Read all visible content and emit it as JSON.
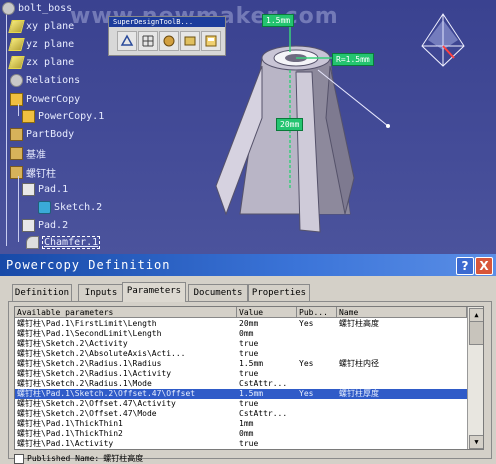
{
  "watermark": "www.newmaker.com",
  "tree": {
    "root": "bolt_boss",
    "items": [
      {
        "label": "xy plane",
        "icon": "plane-icon"
      },
      {
        "label": "yz plane",
        "icon": "plane-icon"
      },
      {
        "label": "zx plane",
        "icon": "plane-icon"
      },
      {
        "label": "Relations",
        "icon": "relations-icon"
      },
      {
        "label": "PowerCopy",
        "icon": "powercopy-icon"
      },
      {
        "label": "PowerCopy.1",
        "icon": "powercopy-icon"
      },
      {
        "label": "PartBody",
        "icon": "partbody-icon"
      },
      {
        "label": "基准",
        "icon": "datum-icon"
      },
      {
        "label": "螺钉柱",
        "icon": "body-icon"
      },
      {
        "label": "Pad.1",
        "icon": "pad-icon"
      },
      {
        "label": "Sketch.2",
        "icon": "sketch-icon"
      },
      {
        "label": "Pad.2",
        "icon": "pad-icon"
      },
      {
        "label": "Chamfer.1",
        "icon": "chamfer-icon"
      }
    ]
  },
  "toolbar": {
    "title": "SuperDesignToolB...",
    "buttons": [
      "sketch-tool-icon",
      "grid-icon",
      "assembly-icon",
      "refresh-icon",
      "catalog-icon"
    ]
  },
  "dimension_labels": {
    "top": "1.5mm",
    "right": "R=1.5mm",
    "middle": "20mm"
  },
  "dialog": {
    "title": "Powercopy Definition",
    "help": "?",
    "close": "X",
    "tabs": [
      "Definition",
      "Inputs",
      "Parameters",
      "Documents",
      "Properties"
    ],
    "active_tab": "Parameters",
    "columns": [
      "Available parameters",
      "Value",
      "Pub...",
      "Name"
    ],
    "rows": [
      {
        "param": "螺钉柱\\Pad.1\\FirstLimit\\Length",
        "value": "20mm",
        "pub": "Yes",
        "name": "螺钉柱高度"
      },
      {
        "param": "螺钉柱\\Pad.1\\SecondLimit\\Length",
        "value": "0mm",
        "pub": "",
        "name": ""
      },
      {
        "param": "螺钉柱\\Sketch.2\\Activity",
        "value": "true",
        "pub": "",
        "name": ""
      },
      {
        "param": "螺钉柱\\Sketch.2\\AbsoluteAxis\\Acti...",
        "value": "true",
        "pub": "",
        "name": ""
      },
      {
        "param": "螺钉柱\\Sketch.2\\Radius.1\\Radius",
        "value": "1.5mm",
        "pub": "Yes",
        "name": "螺钉柱内径"
      },
      {
        "param": "螺钉柱\\Sketch.2\\Radius.1\\Activity",
        "value": "true",
        "pub": "",
        "name": ""
      },
      {
        "param": "螺钉柱\\Sketch.2\\Radius.1\\Mode",
        "value": "CstAttr...",
        "pub": "",
        "name": ""
      },
      {
        "param": "螺钉柱\\Pad.1\\Sketch.2\\Offset.47\\Offset",
        "value": "1.5mm",
        "pub": "Yes",
        "name": "螺钉柱厚度",
        "selected": true
      },
      {
        "param": "螺钉柱\\Sketch.2\\Offset.47\\Activity",
        "value": "true",
        "pub": "",
        "name": ""
      },
      {
        "param": "螺钉柱\\Sketch.2\\Offset.47\\Mode",
        "value": "CstAttr...",
        "pub": "",
        "name": ""
      },
      {
        "param": "螺钉柱\\Pad.1\\ThickThin1",
        "value": "1mm",
        "pub": "",
        "name": ""
      },
      {
        "param": "螺钉柱\\Pad.1\\ThickThin2",
        "value": "0mm",
        "pub": "",
        "name": ""
      },
      {
        "param": "螺钉柱\\Pad.1\\Activity",
        "value": "true",
        "pub": "",
        "name": ""
      }
    ],
    "published_label": "Published Name:",
    "published_value": "螺钉柱高度"
  }
}
